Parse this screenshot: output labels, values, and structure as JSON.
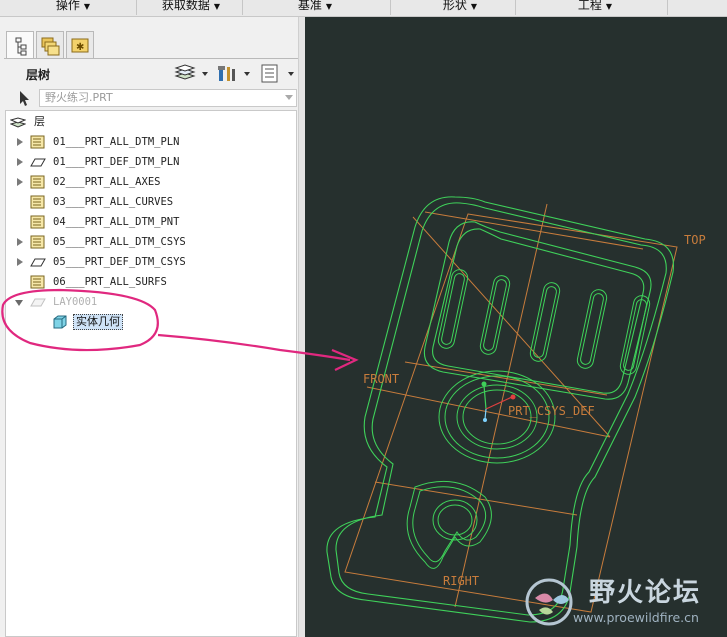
{
  "menubar": {
    "items": [
      "操作",
      "获取数据",
      "基准",
      "形状",
      "工程"
    ]
  },
  "panel": {
    "tabs": [
      "model-tree-icon",
      "layers-icon",
      "favorites-icon"
    ],
    "title": "层树",
    "model_select": "野火练习.PRT",
    "tree": {
      "root_label": "层",
      "layers": [
        {
          "label": "01___PRT_ALL_DTM_PLN",
          "icon": "layer-icon",
          "expandable": true
        },
        {
          "label": "01___PRT_DEF_DTM_PLN",
          "icon": "datum-plane-icon",
          "expandable": true
        },
        {
          "label": "02___PRT_ALL_AXES",
          "icon": "layer-icon",
          "expandable": true
        },
        {
          "label": "03___PRT_ALL_CURVES",
          "icon": "layer-icon",
          "expandable": false
        },
        {
          "label": "04___PRT_ALL_DTM_PNT",
          "icon": "layer-icon",
          "expandable": false
        },
        {
          "label": "05___PRT_ALL_DTM_CSYS",
          "icon": "layer-icon",
          "expandable": true
        },
        {
          "label": "05___PRT_DEF_DTM_CSYS",
          "icon": "datum-plane-icon",
          "expandable": true
        },
        {
          "label": "06___PRT_ALL_SURFS",
          "icon": "layer-icon",
          "expandable": false
        }
      ],
      "hidden_layer": "LAY0001",
      "selected_child": "实体几何"
    }
  },
  "viewport": {
    "datum_labels": {
      "top": "TOP",
      "front": "FRONT",
      "right": "RIGHT",
      "csys": "PRT_CSYS_DEF"
    }
  },
  "watermark": {
    "title": "野火论坛",
    "url": "www.proewildfire.cn"
  },
  "colors": {
    "viewport_bg": "#26302e",
    "geometry": "#3fd15a",
    "datum": "#c77c3c",
    "annotation": "#e0287f",
    "selection": "#cfe3f7"
  }
}
